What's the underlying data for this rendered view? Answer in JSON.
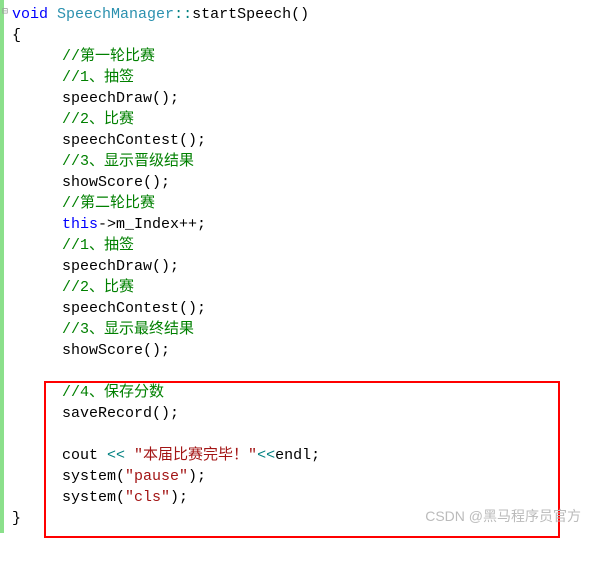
{
  "code": {
    "sig_kw": "void",
    "sig_cls": "SpeechManager",
    "sig_op": "::",
    "sig_fn": "startSpeech",
    "sig_paren": "()",
    "open_brace": "{",
    "close_brace": "}",
    "c_round1": "//第一轮比赛",
    "c_1draw": "//1、抽签",
    "l_draw1": "speechDraw();",
    "c_2contest": "//2、比赛",
    "l_contest1": "speechContest();",
    "c_3show1": "//3、显示晋级结果",
    "l_show1": "showScore();",
    "c_round2": "//第二轮比赛",
    "l_this_kw": "this",
    "l_this_rest": "->m_Index++;",
    "c_1draw2": "//1、抽签",
    "l_draw2": "speechDraw();",
    "c_2contest2": "//2、比赛",
    "l_contest2": "speechContest();",
    "c_3show2": "//3、显示最终结果",
    "l_show2": "showScore();",
    "c_4save": "//4、保存分数",
    "l_save": "saveRecord();",
    "l_cout_pre": "cout ",
    "l_cout_op1": "<<",
    "l_cout_sp1": " ",
    "l_cout_str": "\"本届比赛完毕！\"",
    "l_cout_op2": "<<",
    "l_cout_end": "endl;",
    "l_pause_pre": "system(",
    "l_pause_str": "\"pause\"",
    "l_pause_post": ");",
    "l_cls_pre": "system(",
    "l_cls_str": "\"cls\"",
    "l_cls_post": ");"
  },
  "watermark": "CSDN @黑马程序员官方"
}
